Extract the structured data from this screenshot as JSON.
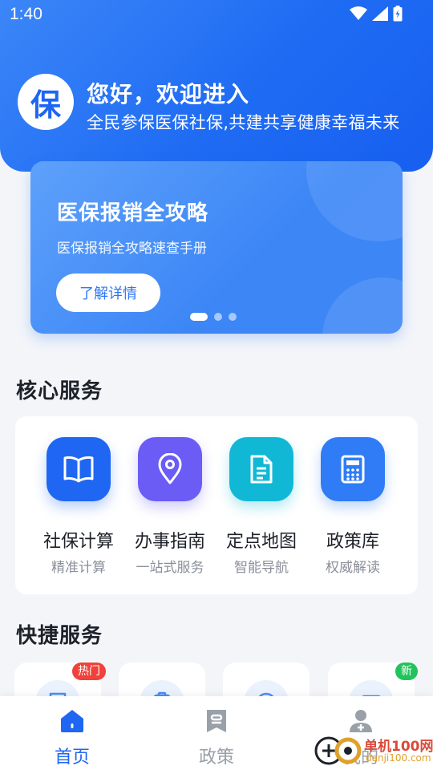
{
  "status_bar": {
    "time": "1:40"
  },
  "header": {
    "logo_char": "保",
    "title": "您好，欢迎进入",
    "subtitle": "全民参保医保社保,共建共享健康幸福未来"
  },
  "banner": {
    "title": "医保报销全攻略",
    "subtitle": "医保报销全攻略速查手册",
    "button_label": "了解详情",
    "active_slide_index": 0,
    "slide_count": 3
  },
  "core_services": {
    "title": "核心服务",
    "items": [
      {
        "name": "社保计算",
        "desc": "精准计算",
        "icon": "book-icon",
        "color": "#1f66f2"
      },
      {
        "name": "办事指南",
        "desc": "一站式服务",
        "icon": "location-pin-icon",
        "color": "#6a5cf5"
      },
      {
        "name": "定点地图",
        "desc": "智能导航",
        "icon": "document-icon",
        "color": "#11b8d6"
      },
      {
        "name": "政策库",
        "desc": "权威解读",
        "icon": "calculator-icon",
        "color": "#2f7cf6"
      }
    ]
  },
  "quick_services": {
    "title": "快捷服务",
    "items": [
      {
        "icon": "receipt-icon",
        "badge": "热门",
        "badge_color": "#f0413a"
      },
      {
        "icon": "clipboard-icon",
        "badge": ""
      },
      {
        "icon": "help-icon",
        "badge": ""
      },
      {
        "icon": "card-icon",
        "badge": "新",
        "badge_color": "#21c35b"
      }
    ]
  },
  "bottom_nav": {
    "items": [
      {
        "label": "首页",
        "icon": "home-icon",
        "active": true
      },
      {
        "label": "政策",
        "icon": "bookmark-icon",
        "active": false
      },
      {
        "label": "我的",
        "icon": "user-icon",
        "active": false
      }
    ],
    "active_color": "#1f66f2",
    "inactive_color": "#9aa0a8"
  },
  "watermark": {
    "line1": "单机100网",
    "line2": "danji100.com"
  },
  "colors": {
    "primary": "#1f66f2",
    "page_bg": "#f3f5f9"
  }
}
